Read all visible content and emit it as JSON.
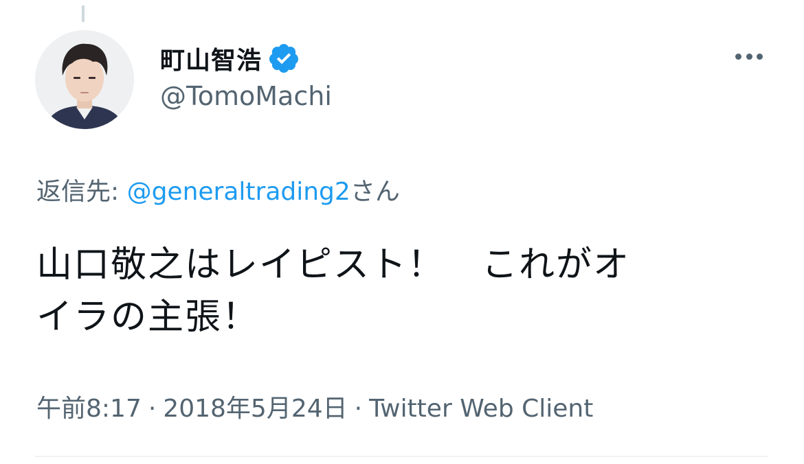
{
  "tweet": {
    "author": {
      "display_name": "町山智浩",
      "handle": "@TomoMachi",
      "verified": true,
      "verified_icon": "verified-badge-icon"
    },
    "more_icon": "more-dots-icon",
    "reply_to": {
      "prefix": "返信先: ",
      "mention": "@generaltrading2",
      "suffix": "さん"
    },
    "text_lines": [
      "山口敬之はレイピスト！　これがオ",
      "イラの主張！"
    ],
    "meta": {
      "time": "午前8:17",
      "separator": "·",
      "date": "2018年5月24日",
      "client": "Twitter Web Client"
    }
  },
  "colors": {
    "text_primary": "#0f1419",
    "text_secondary": "#536471",
    "link": "#1d9bf0",
    "verified": "#1d9bf0",
    "divider": "#eff3f4"
  }
}
